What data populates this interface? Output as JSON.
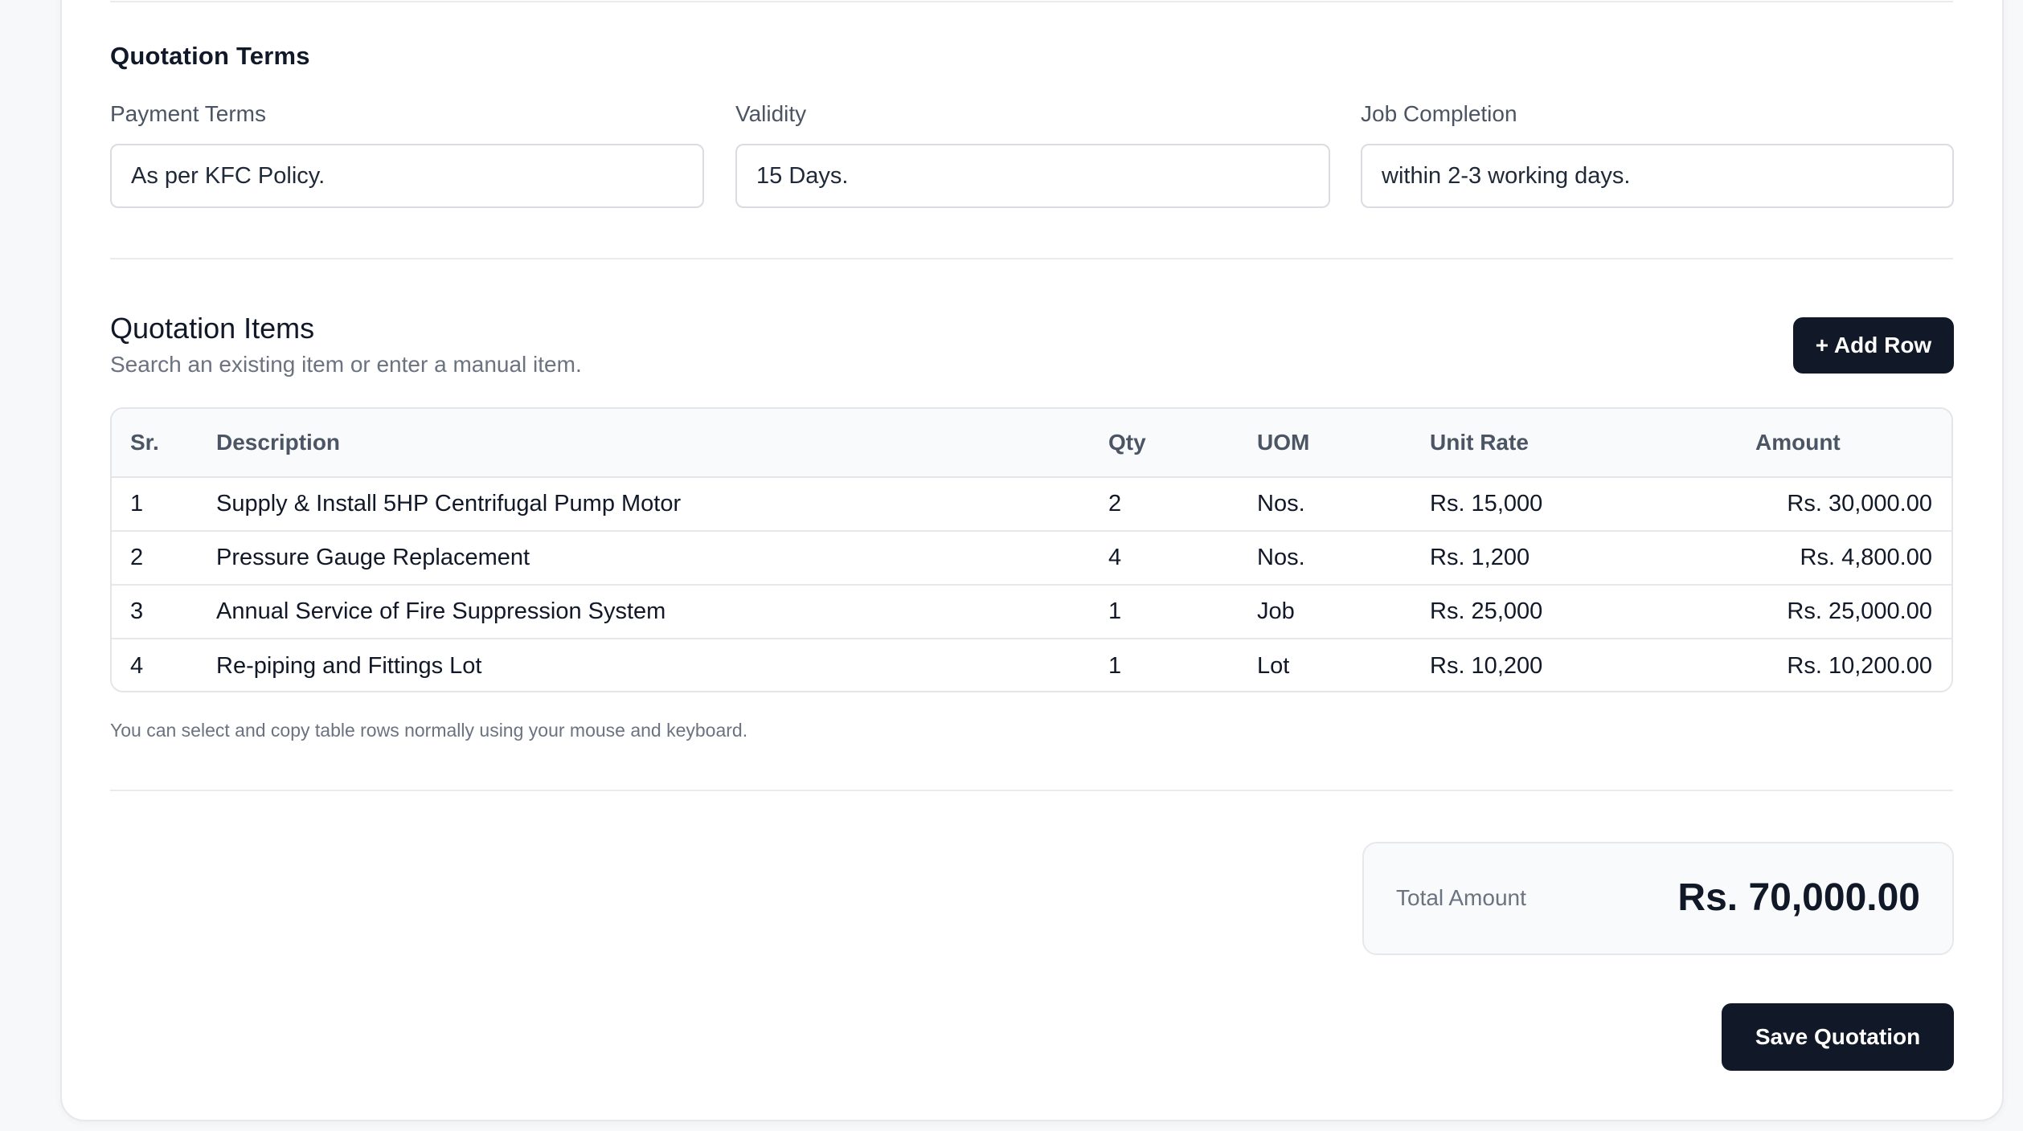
{
  "terms": {
    "title": "Quotation Terms",
    "payment": {
      "label": "Payment Terms",
      "value": "As per KFC Policy."
    },
    "validity": {
      "label": "Validity",
      "value": "15 Days."
    },
    "completion": {
      "label": "Job Completion",
      "value": "within 2-3 working days."
    }
  },
  "items": {
    "title": "Quotation Items",
    "subtitle": "Search an existing item or enter a manual item.",
    "add_row_label": "+ Add Row",
    "columns": [
      "Sr.",
      "Description",
      "Qty",
      "UOM",
      "Unit Rate",
      "Amount"
    ],
    "rows": [
      {
        "sr": "1",
        "description": "Supply & Install 5HP Centrifugal Pump Motor",
        "qty": "2",
        "uom": "Nos.",
        "rate": "Rs. 15,000",
        "amount": "Rs. 30,000.00"
      },
      {
        "sr": "2",
        "description": "Pressure Gauge Replacement",
        "qty": "4",
        "uom": "Nos.",
        "rate": "Rs. 1,200",
        "amount": "Rs. 4,800.00"
      },
      {
        "sr": "3",
        "description": "Annual Service of Fire Suppression System",
        "qty": "1",
        "uom": "Job",
        "rate": "Rs. 25,000",
        "amount": "Rs. 25,000.00"
      },
      {
        "sr": "4",
        "description": "Re-piping and Fittings Lot",
        "qty": "1",
        "uom": "Lot",
        "rate": "Rs. 10,200",
        "amount": "Rs. 10,200.00"
      }
    ],
    "note": "You can select and copy table rows normally using your mouse and keyboard."
  },
  "total": {
    "label": "Total Amount",
    "value": "Rs. 70,000.00"
  },
  "save_label": "Save Quotation",
  "colors": {
    "accent": "#111827",
    "border": "#e3e5e9",
    "muted": "#6b7280"
  }
}
